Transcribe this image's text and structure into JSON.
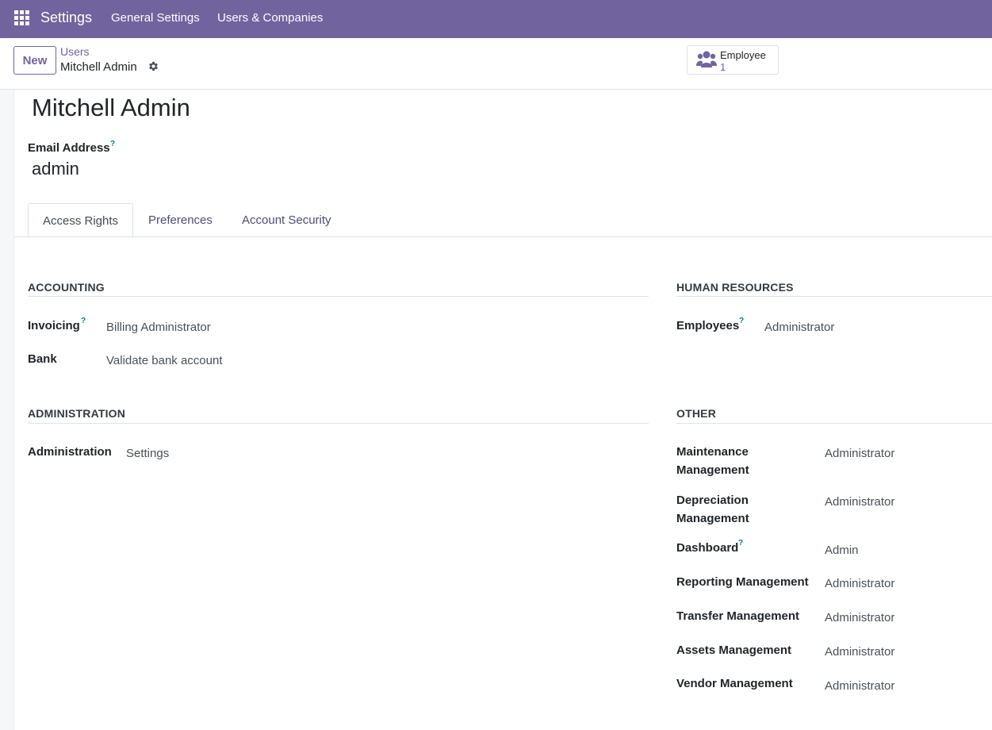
{
  "navbar": {
    "brand": "Settings",
    "menu": [
      "General Settings",
      "Users & Companies"
    ]
  },
  "control_panel": {
    "new_label": "New",
    "breadcrumb_parent": "Users",
    "breadcrumb_current": "Mitchell Admin",
    "smart_button": {
      "label": "Employee",
      "value": "1"
    }
  },
  "form": {
    "name": "Mitchell Admin",
    "email_label": "Email Address",
    "email_value": "admin",
    "help_mark": "?"
  },
  "tabs": [
    "Access Rights",
    "Preferences",
    "Account Security"
  ],
  "sections": {
    "accounting": {
      "title": "ACCOUNTING",
      "rows": [
        {
          "label": "Invoicing",
          "value": "Billing Administrator"
        },
        {
          "label": "Bank",
          "value": "Validate bank account"
        }
      ]
    },
    "human_resources": {
      "title": "HUMAN RESOURCES",
      "rows": [
        {
          "label": "Employees",
          "value": "Administrator"
        }
      ]
    },
    "administration": {
      "title": "ADMINISTRATION",
      "rows": [
        {
          "label": "Administration",
          "value": "Settings"
        }
      ]
    },
    "other": {
      "title": "OTHER",
      "rows": [
        {
          "label_line1": "Maintenance",
          "label_line2": "Management",
          "value": "Administrator"
        },
        {
          "label_line1": "Depreciation",
          "label_line2": "Management",
          "value": "Administrator"
        },
        {
          "label": "Dashboard",
          "value": "Admin"
        },
        {
          "label": "Reporting Management",
          "value": "Administrator"
        },
        {
          "label": "Transfer Management",
          "value": "Administrator"
        },
        {
          "label": "Assets Management",
          "value": "Administrator"
        },
        {
          "label": "Vendor Management",
          "value": "Administrator"
        }
      ]
    }
  },
  "colors": {
    "brand": "#71639e",
    "help": "#017e84"
  }
}
